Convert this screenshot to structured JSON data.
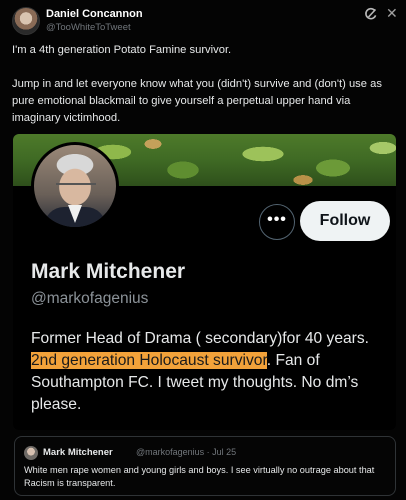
{
  "post": {
    "author_name": "Daniel Concannon",
    "author_handle": "@TooWhiteToTweet",
    "paragraphs": [
      "I'm a 4th generation Potato Famine survivor.",
      "Jump in and let everyone know what you (didn't) survive and (don't) use as pure emotional blackmail to give yourself a perpetual upper hand via imaginary victimhood."
    ]
  },
  "embed": {
    "more_label": "•••",
    "follow_label": "Follow",
    "profile_name": "Mark Mitchener",
    "profile_handle": "@markofagenius",
    "bio_part1": "Former Head of Drama ( secondary)for 40 years. ",
    "bio_highlight": "2nd generation  Holocaust survivor",
    "bio_part2": ". Fan of Southampton FC. I tweet my thoughts. No dm’s please."
  },
  "quote": {
    "name": "Mark Mitchener",
    "handle_date": "@markofagenius · Jul 25",
    "text": "White men rape women and young girls and  boys. I see virtually no  outrage about that Racism is transparent."
  },
  "icons": {
    "grok": "grok-icon",
    "close": "close-icon"
  },
  "colors": {
    "background": "#000000",
    "highlight": "#f2a23a",
    "follow_button": "#eff3f4"
  }
}
